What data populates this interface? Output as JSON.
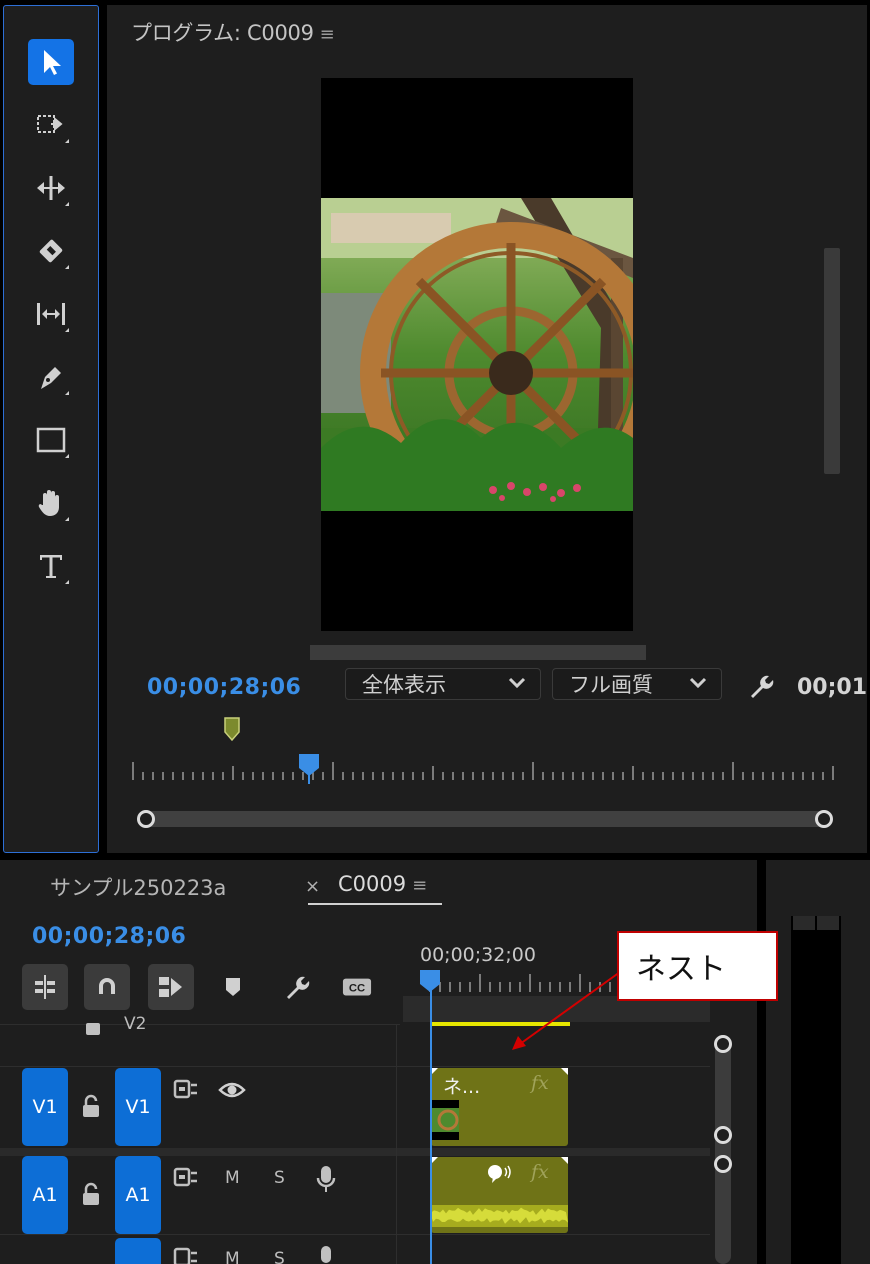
{
  "program_monitor": {
    "title": "プログラム: C0009",
    "menu_icon": "≡",
    "timecode_current": "00;00;28;06",
    "fit_dropdown": "全体表示",
    "quality_dropdown": "フル画質",
    "timecode_duration": "00;01"
  },
  "tools": [
    {
      "name": "selection-tool",
      "icon": "selection-arrow-icon",
      "active": true
    },
    {
      "name": "track-select-forward-tool",
      "icon": "track-select-icon",
      "active": false
    },
    {
      "name": "ripple-edit-tool",
      "icon": "ripple-edit-icon",
      "active": false
    },
    {
      "name": "razor-tool",
      "icon": "razor-icon",
      "active": false
    },
    {
      "name": "slip-tool",
      "icon": "slip-icon",
      "active": false
    },
    {
      "name": "pen-tool",
      "icon": "pen-icon",
      "active": false
    },
    {
      "name": "rectangle-tool",
      "icon": "rectangle-icon",
      "active": false
    },
    {
      "name": "hand-tool",
      "icon": "hand-icon",
      "active": false
    },
    {
      "name": "type-tool",
      "icon": "type-icon",
      "active": false
    }
  ],
  "timeline": {
    "tabs": [
      {
        "label": "サンプル250223a",
        "active": false
      },
      {
        "label": "C0009",
        "active": true
      }
    ],
    "close_glyph": "×",
    "menu_icon": "≡",
    "timecode": "00;00;28;06",
    "ruler_timecode": "00;00;32;00",
    "toolbar": [
      "insert-sequence-nest-icon",
      "snap-magnet-icon",
      "linked-selection-icon",
      "add-marker-icon",
      "wrench-icon",
      "captions-icon"
    ],
    "captions_label": "CC",
    "tracks": {
      "v2": {
        "label": "V2"
      },
      "v1": {
        "source": "V1",
        "target": "V1"
      },
      "a1": {
        "source": "A1",
        "target": "A1",
        "mute": "M",
        "solo": "S"
      },
      "a2": {
        "mute": "M",
        "solo": "S"
      }
    },
    "clips": {
      "video": {
        "label": "ネ...",
        "fx": "fx"
      },
      "audio": {
        "fx": "fx"
      }
    }
  },
  "callout": {
    "text": "ネスト",
    "border_color": "#c00000"
  },
  "colors": {
    "accent_blue": "#1473e6",
    "timecode_blue": "#3a8ee6",
    "clip_olive": "#6f7317",
    "work_area_yellow": "#e6e600"
  }
}
